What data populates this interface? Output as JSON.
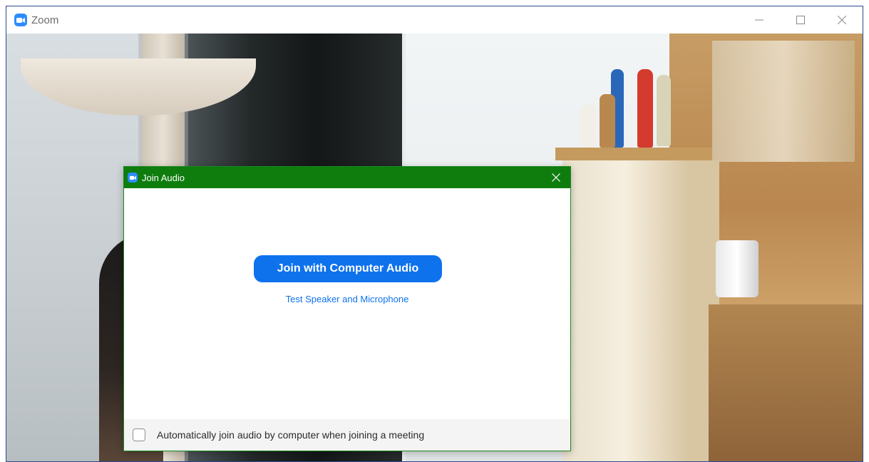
{
  "window": {
    "title": "Zoom",
    "icons": {
      "app": "zoom-camera-icon",
      "minimize": "minimize-icon",
      "maximize": "maximize-icon",
      "close": "close-icon"
    }
  },
  "dialog": {
    "title": "Join Audio",
    "join_button_label": "Join with Computer Audio",
    "test_link_label": "Test Speaker and Microphone",
    "auto_join_label": "Automatically join audio by computer when joining a meeting",
    "auto_join_checked": false,
    "icons": {
      "app": "zoom-camera-icon",
      "close": "close-icon"
    }
  },
  "colors": {
    "accent": "#0e72ed",
    "dialog_titlebar": "#0e7d0e",
    "zoom_brand": "#2d8cff"
  }
}
